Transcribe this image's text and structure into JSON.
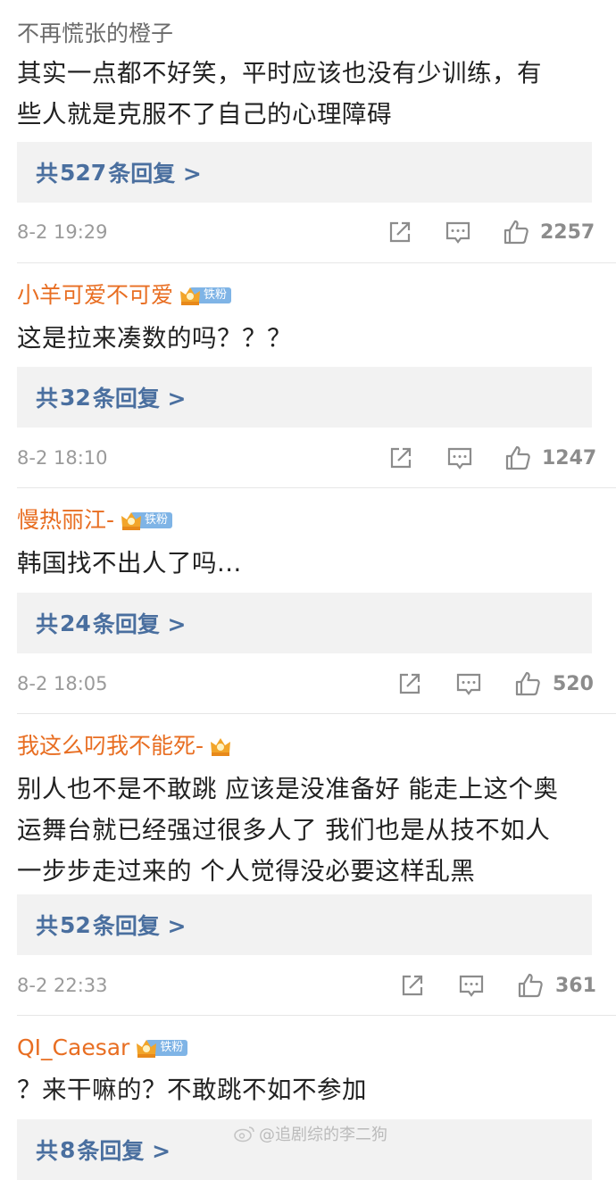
{
  "comments": [
    {
      "username": "不再慌张的橙子",
      "text_lines": [
        "其实一点都不好笑，平时应该也没有少训练，有",
        "些人就是克服不了自己的心理障碍"
      ],
      "reply_prefix": "共",
      "reply_count": "527",
      "reply_suffix": "条回复 >",
      "time": "8-2 19:29",
      "likes": "2257"
    },
    {
      "username": "小羊可爱不可爱",
      "badge": "铁粉",
      "text_lines": [
        "这是拉来凑数的吗？？？"
      ],
      "reply_prefix": "共",
      "reply_count": "32",
      "reply_suffix": "条回复 >",
      "time": "8-2 18:10",
      "likes": "1247"
    },
    {
      "username": "慢热丽江-",
      "badge": "铁粉",
      "text_lines": [
        "韩国找不出人了吗..."
      ],
      "reply_prefix": "共",
      "reply_count": "24",
      "reply_suffix": "条回复 >",
      "time": "8-2 18:05",
      "likes": "520"
    },
    {
      "username": "我这么叼我不能死-",
      "text_lines": [
        "别人也不是不敢跳 应该是没准备好 能走上这个奥",
        "运舞台就已经强过很多人了 我们也是从技不如人",
        "一步步走过来的 个人觉得没必要这样乱黑"
      ],
      "reply_prefix": "共",
      "reply_count": "52",
      "reply_suffix": "条回复 >",
      "time": "8-2 22:33",
      "likes": "361"
    },
    {
      "username": "QI_Caesar",
      "badge": "铁粉",
      "text_lines": [
        "？来干嘛的？不敢跳不如不参加"
      ],
      "reply_prefix": "共",
      "reply_count": "8",
      "reply_suffix": "条回复 >"
    }
  ],
  "watermark": "@追剧综的李二狗",
  "colors": {
    "username": "#e86e22",
    "reply_link": "#4a6f9f",
    "badge": "#7fb4e6",
    "crown": "#f2a52a"
  },
  "icons": [
    "share-icon",
    "comment-icon",
    "like-icon",
    "crown-icon",
    "weibo-icon"
  ]
}
